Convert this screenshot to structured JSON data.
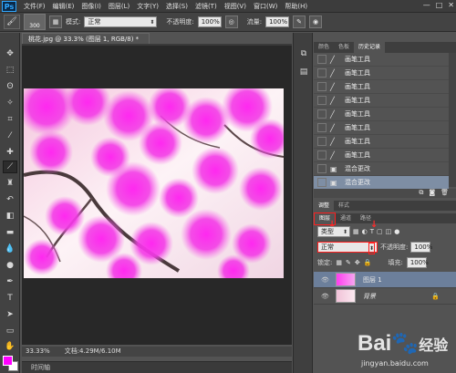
{
  "menubar": {
    "logo": "Ps",
    "items": [
      "文件(F)",
      "编辑(E)",
      "图像(I)",
      "图层(L)",
      "文字(Y)",
      "选择(S)",
      "滤镜(T)",
      "视图(V)",
      "窗口(W)",
      "帮助(H)"
    ],
    "window_buttons": [
      "—",
      "□",
      "✕"
    ]
  },
  "options": {
    "brush_size": "300",
    "mode_label": "模式:",
    "mode_value": "正常",
    "opacity_label": "不透明度:",
    "opacity_value": "100%",
    "flow_label": "流量:",
    "flow_value": "100%"
  },
  "document": {
    "tab_title": "桃花.jpg @ 33.3% (图层 1, RGB/8) *",
    "tab_close": "×"
  },
  "status": {
    "zoom": "33.33%",
    "doc_info": "文档:4.29M/6.10M"
  },
  "timeline": {
    "label": "时间轴"
  },
  "history_panel": {
    "tabs": [
      "颜色",
      "色板",
      "历史记录"
    ],
    "active_tab": "历史记录",
    "items": [
      {
        "label": "画笔工具",
        "icon": "brush-icon"
      },
      {
        "label": "画笔工具",
        "icon": "brush-icon"
      },
      {
        "label": "画笔工具",
        "icon": "brush-icon"
      },
      {
        "label": "画笔工具",
        "icon": "brush-icon"
      },
      {
        "label": "画笔工具",
        "icon": "brush-icon"
      },
      {
        "label": "画笔工具",
        "icon": "brush-icon"
      },
      {
        "label": "画笔工具",
        "icon": "brush-icon"
      },
      {
        "label": "画笔工具",
        "icon": "brush-icon"
      },
      {
        "label": "混合更改",
        "icon": "blend-icon"
      },
      {
        "label": "混合更改",
        "icon": "blend-icon"
      }
    ]
  },
  "adjust_tabs": [
    "调整",
    "样式"
  ],
  "layers_panel": {
    "tabs": [
      "图层",
      "通道",
      "路径"
    ],
    "kind_label": "类型",
    "blend_mode": "正常",
    "opacity_label": "不透明度:",
    "opacity_value": "100%",
    "lock_label": "锁定:",
    "fill_label": "填充:",
    "fill_value": "100%",
    "layers": [
      {
        "name": "图层 1",
        "selected": true
      },
      {
        "name": "背景",
        "selected": false
      }
    ]
  },
  "watermark": {
    "brand": "Bai",
    "brand2": "经验",
    "url": "jingyan.baidu.com"
  },
  "colors": {
    "foreground": "#ff00ff",
    "background": "#ffffff",
    "highlight": "#ff1e1e"
  }
}
